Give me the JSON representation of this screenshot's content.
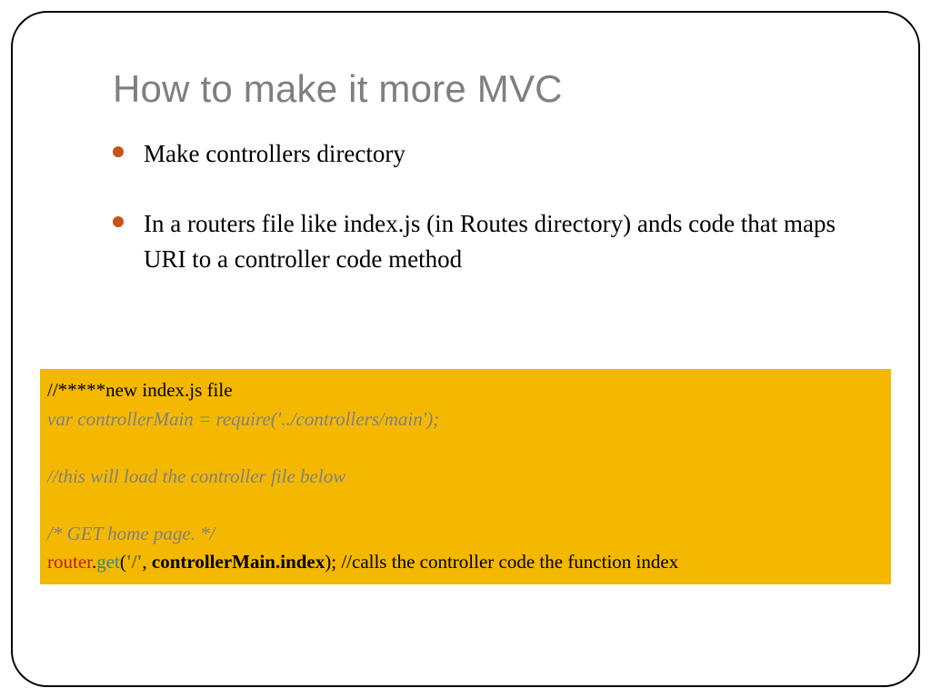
{
  "title": "How to make it more MVC",
  "bullets": [
    "Make controllers directory",
    "In a routers file like index.js (in Routes directory) ands code that maps URI to a controller code method"
  ],
  "code": {
    "l1": "//*****new index.js file",
    "l2": "var controllerMain = require('../controllers/main');",
    "l4": "//this will load the controller file below",
    "l6": "/* GET home page. */",
    "l7_router": "router",
    "l7_dot": ".",
    "l7_get": "get",
    "l7_open": "(",
    "l7_path": "'/'",
    "l7_comma": ", ",
    "l7_ctrl": "controllerMain.index",
    "l7_close": "); ",
    "l7_comment": "//calls the controller code the function index"
  }
}
